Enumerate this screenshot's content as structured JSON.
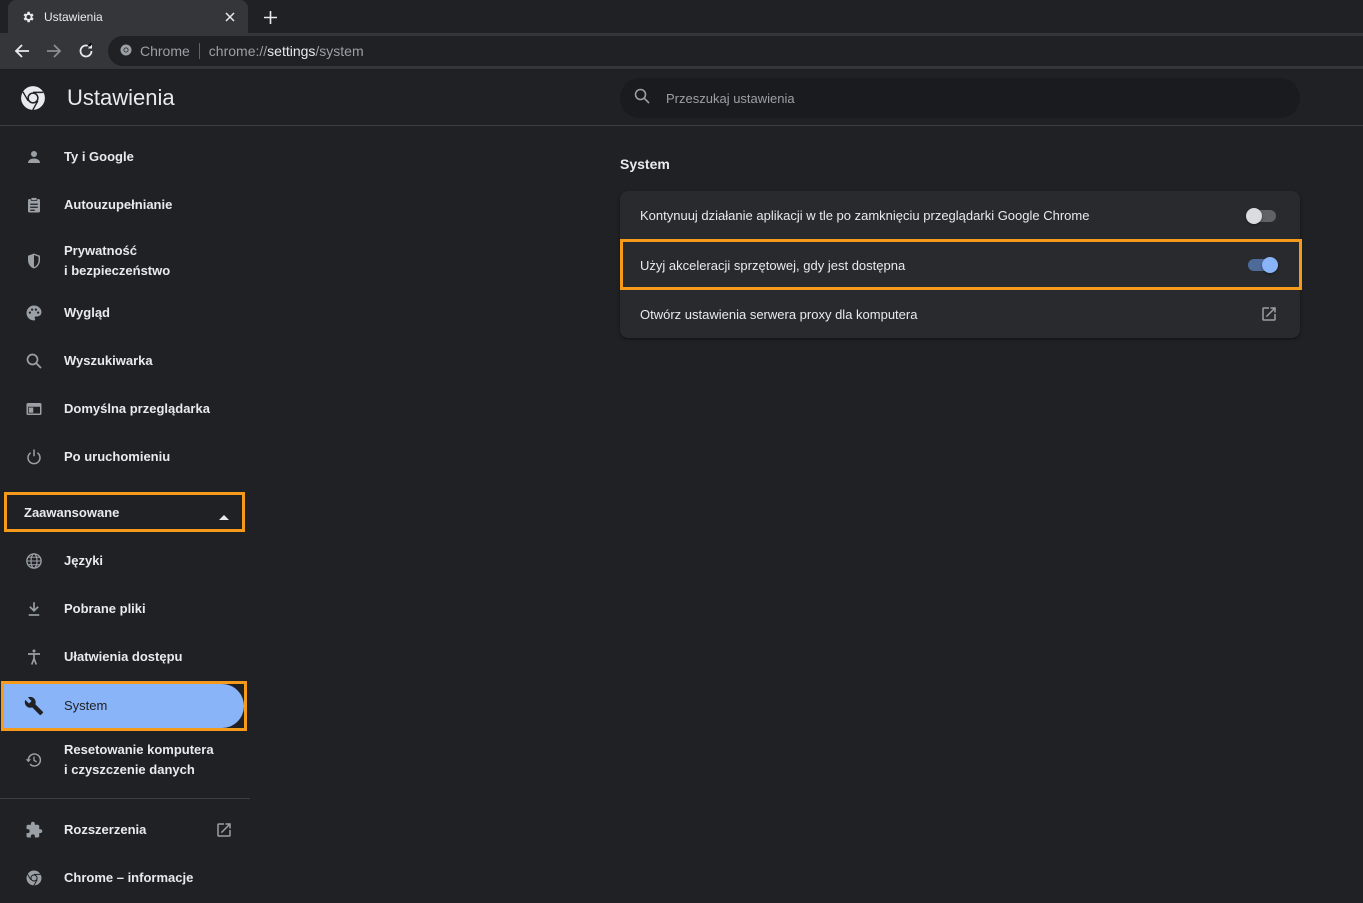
{
  "tab": {
    "title": "Ustawienia"
  },
  "omnibox": {
    "site_label": "Chrome",
    "url_scheme": "chrome://",
    "url_host": "settings",
    "url_path": "/system"
  },
  "header": {
    "title": "Ustawienia",
    "search_placeholder": "Przeszukaj ustawienia"
  },
  "sidebar": {
    "items": [
      {
        "label": "Ty i Google",
        "icon": "person-icon"
      },
      {
        "label": "Autouzupełnianie",
        "icon": "clipboard-icon"
      },
      {
        "label_line1": "Prywatność",
        "label_line2": "i bezpieczeństwo",
        "icon": "shield-icon"
      },
      {
        "label": "Wygląd",
        "icon": "palette-icon"
      },
      {
        "label": "Wyszukiwarka",
        "icon": "search-icon"
      },
      {
        "label": "Domyślna przeglądarka",
        "icon": "browser-icon"
      },
      {
        "label": "Po uruchomieniu",
        "icon": "power-icon"
      }
    ],
    "advanced_label": "Zaawansowane",
    "advanced_items": [
      {
        "label": "Języki",
        "icon": "globe-icon"
      },
      {
        "label": "Pobrane pliki",
        "icon": "download-icon"
      },
      {
        "label": "Ułatwienia dostępu",
        "icon": "accessibility-icon"
      },
      {
        "label": "System",
        "icon": "wrench-icon",
        "active": true
      },
      {
        "label_line1": "Resetowanie komputera",
        "label_line2": "i czyszczenie danych",
        "icon": "history-icon"
      }
    ],
    "footer_items": [
      {
        "label": "Rozszerzenia",
        "icon": "puzzle-icon"
      },
      {
        "label": "Chrome – informacje",
        "icon": "chrome-icon"
      }
    ]
  },
  "main": {
    "section_title": "System",
    "rows": [
      {
        "label": "Kontynuuj działanie aplikacji w tle po zamknięciu przeglądarki Google Chrome",
        "toggle": false
      },
      {
        "label": "Użyj akceleracji sprzętowej, gdy jest dostępna",
        "toggle": true
      },
      {
        "label": "Otwórz ustawienia serwera proxy dla komputera",
        "action": "open-in-new-icon"
      }
    ]
  },
  "colors": {
    "background": "#202124",
    "accent": "#8ab4f8",
    "highlight": "#f59a1b",
    "card": "#292a2d"
  }
}
